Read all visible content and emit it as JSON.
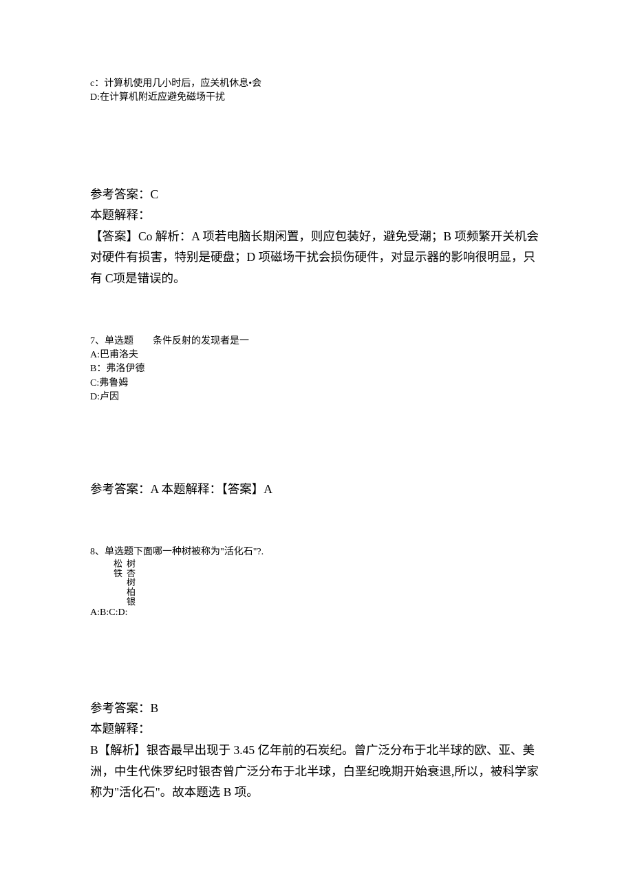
{
  "q6": {
    "optC": "c：计算机使用几小时后，应关机休息•会",
    "optD": "D:在计算机附近应避免磁场干扰",
    "ans_label": "参考答案：C",
    "expl_label": "本题解释：",
    "expl_body": "【答案】Co 解析：A 项若电脑长期闲置，则应包装好，避免受潮；B 项频繁开关机会对硬件有损害，特别是硬盘；D 项磁场干扰会损伤硬件，对显示器的影响很明显，只有 C项是错误的。"
  },
  "q7": {
    "stem": "7、单选题　　条件反射的发现者是一",
    "optA": "A:巴甫洛夫",
    "optB": "B：弗洛伊德",
    "optC": "C:弗鲁姆",
    "optD": "D:卢因",
    "ans_line": "参考答案：A 本题解释：【答案】A"
  },
  "q8": {
    "stem": "8、单选题下面哪一种树被称为\"活化石\"?.",
    "col1": "松铁",
    "col2": "树杏树柏银",
    "labels": "A:B:C:D:",
    "ans_label": "参考答案：B",
    "expl_label": "本题解释：",
    "expl_body": "B【解析】银杏最早出现于 3.45 亿年前的石炭纪。曾广泛分布于北半球的欧、亚、美洲，中生代侏罗纪时银杏曾广泛分布于北半球，白垩纪晚期开始衰退,所以，被科学家称为\"活化石\"。故本题选 B 项。"
  }
}
